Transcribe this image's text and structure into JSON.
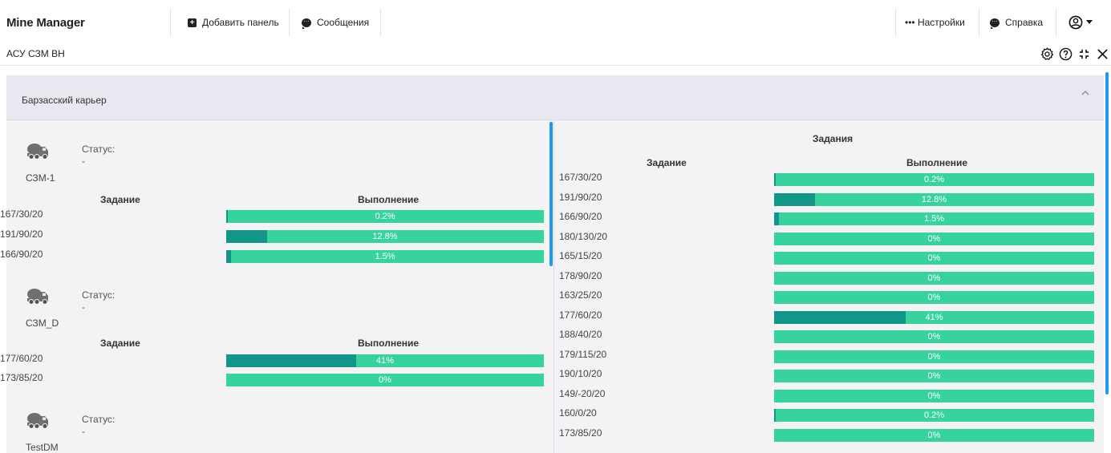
{
  "app": {
    "brand": "Mine Manager"
  },
  "navbar": {
    "add_panel": "Добавить панель",
    "messages": "Сообщения",
    "settings": "••• Настройки",
    "help": "Справка"
  },
  "panel": {
    "title": "АСУ СЗМ ВН"
  },
  "section": {
    "title": "Барзасский карьер"
  },
  "left": {
    "machines": [
      {
        "name": "СЗМ-1",
        "status_label": "Статус:",
        "status_value": "-",
        "task_header": "Задание",
        "progress_header": "Выполнение",
        "tasks": [
          {
            "code": "167/30/20",
            "label": "0.2%",
            "progress": 0.002
          },
          {
            "code": "191/90/20",
            "label": "12.8%",
            "progress": 0.128
          },
          {
            "code": "166/90/20",
            "label": "1.5%",
            "progress": 0.015
          }
        ]
      },
      {
        "name": "СЗМ_D",
        "status_label": "Статус:",
        "status_value": "-",
        "task_header": "Задание",
        "progress_header": "Выполнение",
        "tasks": [
          {
            "code": "177/60/20",
            "label": "41%",
            "progress": 0.41
          },
          {
            "code": "173/85/20",
            "label": "0%",
            "progress": 0
          }
        ]
      },
      {
        "name": "TestDM",
        "status_label": "Статус:",
        "status_value": "-"
      }
    ]
  },
  "right": {
    "title": "Задания",
    "task_header": "Задание",
    "progress_header": "Выполнение",
    "tasks": [
      {
        "code": "167/30/20",
        "label": "0.2%",
        "progress": 0.002
      },
      {
        "code": "191/90/20",
        "label": "12.8%",
        "progress": 0.128
      },
      {
        "code": "166/90/20",
        "label": "1.5%",
        "progress": 0.015
      },
      {
        "code": "180/130/20",
        "label": "0%",
        "progress": 0
      },
      {
        "code": "165/15/20",
        "label": "0%",
        "progress": 0
      },
      {
        "code": "178/90/20",
        "label": "0%",
        "progress": 0
      },
      {
        "code": "163/25/20",
        "label": "0%",
        "progress": 0
      },
      {
        "code": "177/60/20",
        "label": "41%",
        "progress": 0.41
      },
      {
        "code": "188/40/20",
        "label": "0%",
        "progress": 0
      },
      {
        "code": "179/115/20",
        "label": "0%",
        "progress": 0
      },
      {
        "code": "190/10/20",
        "label": "0%",
        "progress": 0
      },
      {
        "code": "149/-20/20",
        "label": "0%",
        "progress": 0
      },
      {
        "code": "160/0/20",
        "label": "0.2%",
        "progress": 0.002
      },
      {
        "code": "173/85/20",
        "label": "0%",
        "progress": 0
      }
    ]
  },
  "colors": {
    "bar_bg": "#36d39c",
    "bar_fill": "#12968a",
    "accent": "#2196f3"
  },
  "icons": [
    "plus-box-icon",
    "chat-bubble-icon",
    "chat-bubble-icon",
    "user-circle-icon",
    "caret-down-icon",
    "gear-icon",
    "help-circle-icon",
    "collapse-icon",
    "close-icon",
    "chevron-up-icon",
    "truck-icon"
  ]
}
